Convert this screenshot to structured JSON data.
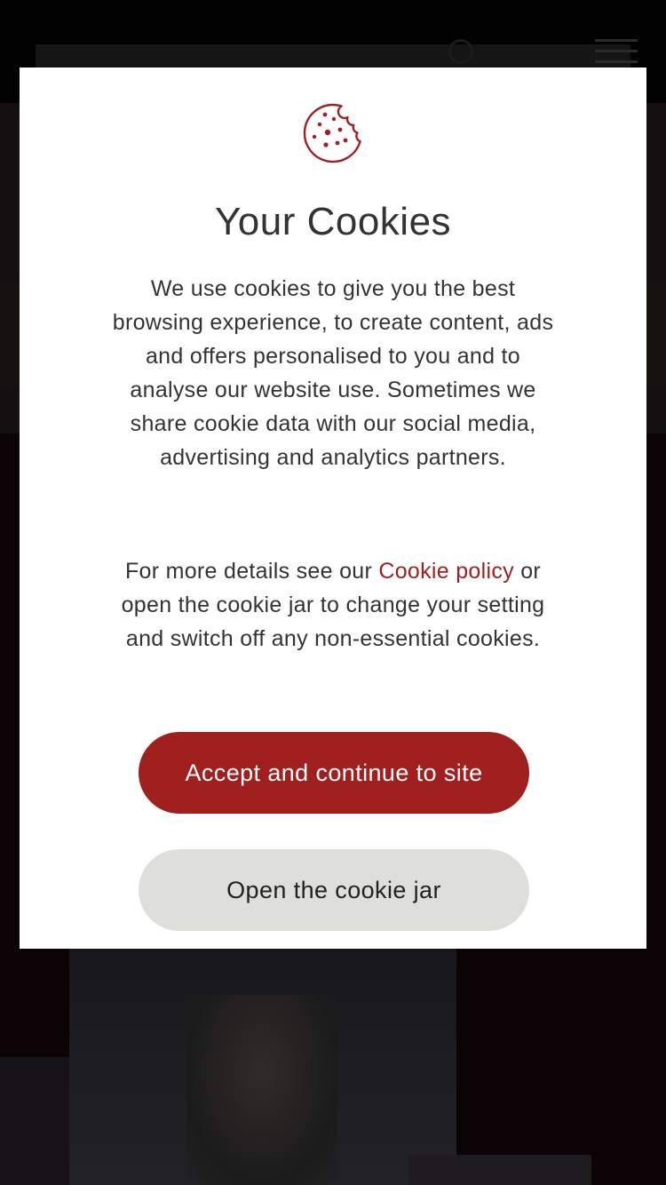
{
  "colors": {
    "accent": "#a0201f",
    "modal_background": "#ffffff",
    "secondary_button": "#dededa",
    "text": "#333333"
  },
  "cookie_banner": {
    "icon": "cookie-icon",
    "title": "Your Cookies",
    "body": "We use cookies to give you the best browsing experience, to create content, ads and offers personalised to you and to analyse our website use. Sometimes we share cookie data with our social media, advertising and analytics partners.",
    "details_prefix": "For more details see our ",
    "policy_link_label": "Cookie policy",
    "details_suffix": " or open the cookie jar to change your setting and switch off any non-essential cookies.",
    "accept_button_label": "Accept and continue to site",
    "open_jar_button_label": "Open the cookie jar"
  },
  "background_page": {
    "header_icons": [
      "search-icon",
      "hamburger-menu-icon"
    ]
  }
}
